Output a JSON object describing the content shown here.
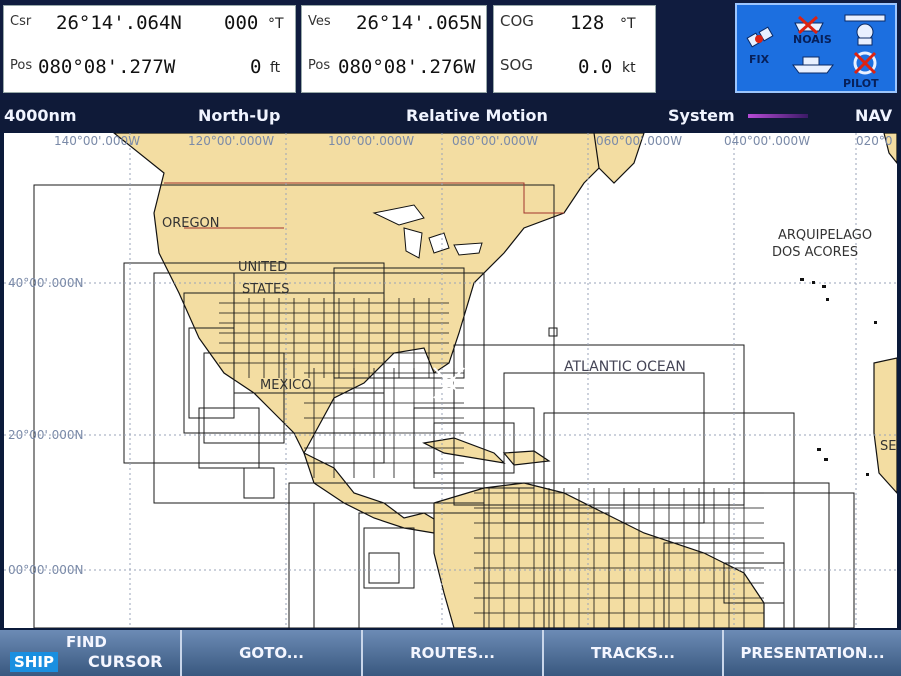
{
  "panels": {
    "cursor": {
      "rows": [
        {
          "label": "Csr",
          "value": "26°14'.064N",
          "extra": "000",
          "unit": "°T"
        },
        {
          "label": "Pos",
          "value": "080°08'.277W",
          "extra": "0",
          "unit": "ft"
        }
      ]
    },
    "vessel": {
      "rows": [
        {
          "label": "Ves",
          "value": "26°14'.065N"
        },
        {
          "label": "Pos",
          "value": "080°08'.276W"
        }
      ]
    },
    "motion": {
      "rows": [
        {
          "label": "COG",
          "value": "128",
          "unit": "°T"
        },
        {
          "label": "SOG",
          "value": "0.0",
          "unit": "kt"
        }
      ]
    }
  },
  "icons": {
    "noais": "NOAIS",
    "fix": "FIX",
    "pilot": "PILOT"
  },
  "status": {
    "range": "4000nm",
    "orientation": "North-Up",
    "motion": "Relative Motion",
    "system": "System",
    "mode": "NAV"
  },
  "chart": {
    "longitudes": [
      "140°00'.000W",
      "120°00'.000W",
      "100°00'.000W",
      "080°00'.000W",
      "060°00'.000W",
      "040°00'.000W",
      "020°0"
    ],
    "latitudes": [
      "40°00'.000N",
      "20°00'.000N",
      "00°00'.000N"
    ],
    "labels": {
      "oregon": "OREGON",
      "united": "UNITED",
      "states": "STATES",
      "mexico": "MEXICO",
      "atlantic": "ATLANTIC OCEAN",
      "azores1": "ARQUIPELAGO",
      "azores2": "DOS ACORES",
      "se": "SE"
    },
    "colors": {
      "land": "#f3dda2",
      "water": "#ffffff",
      "grid": "#9aa3b8"
    }
  },
  "softkeys": {
    "ship": "SHIP",
    "find": "FIND",
    "cursor": "CURSOR",
    "goto": "GOTO...",
    "routes": "ROUTES...",
    "tracks": "TRACKS...",
    "presentation": "PRESENTATION..."
  }
}
